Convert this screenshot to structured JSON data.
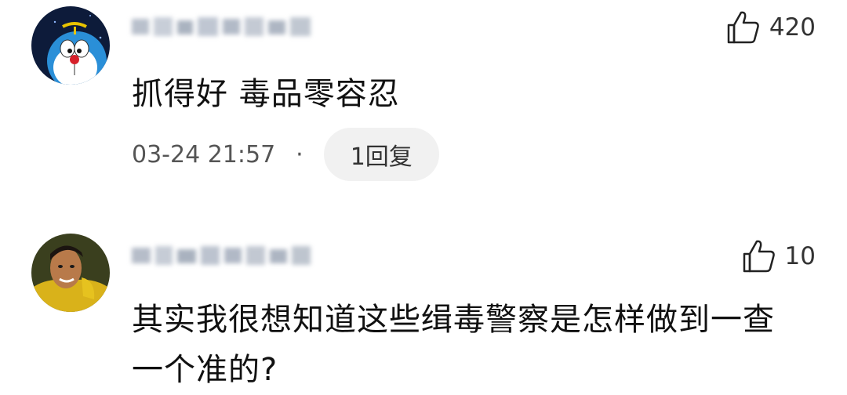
{
  "comments": [
    {
      "likes": "420",
      "text": "抓得好 毒品零容忍",
      "timestamp": "03-24 21:57",
      "separator": "·",
      "reply_label": "1回复",
      "avatar": "doraemon-avatar"
    },
    {
      "likes": "10",
      "text": "其实我很想知道这些缉毒警察是怎样做到一查一个准的?",
      "avatar": "man-portrait-avatar"
    }
  ],
  "colors": {
    "text": "#111111",
    "meta": "#555555",
    "reply_bg": "#f1f1f1",
    "icon_stroke": "#222222"
  }
}
